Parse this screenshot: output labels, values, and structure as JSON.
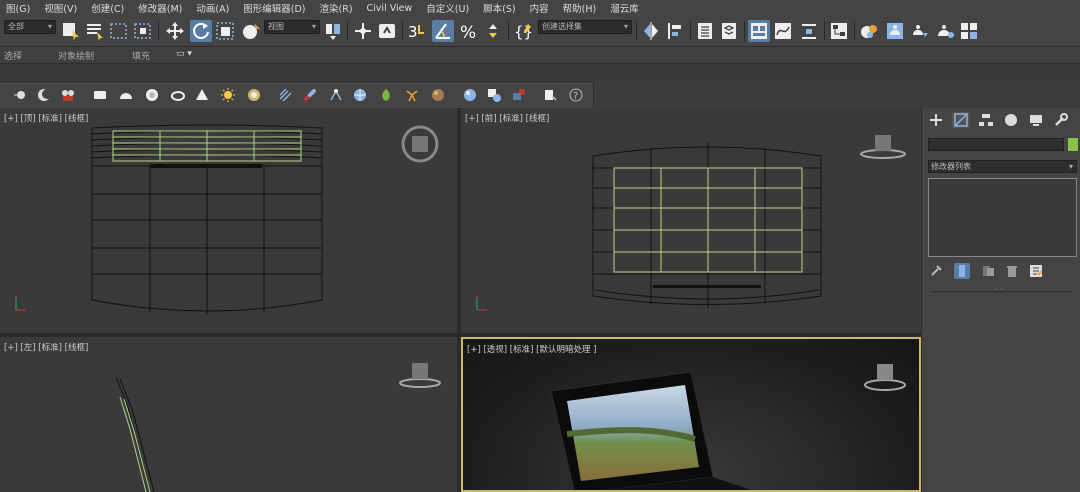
{
  "menu": [
    "图(G)",
    "视图(V)",
    "创建(C)",
    "修改器(M)",
    "动画(A)",
    "图形编辑器(D)",
    "渲染(R)",
    "Civil View",
    "自定义(U)",
    "脚本(S)",
    "内容",
    "帮助(H)",
    "溜云库"
  ],
  "toolbar": {
    "selection_filter": "全部",
    "ref_coord": "视图",
    "named_selection": "创建选择集"
  },
  "ribbon": {
    "tabs": [
      "选择",
      "对象绘制",
      "填充"
    ]
  },
  "viewports": {
    "top": "[+] [顶] [标准] [线框]",
    "front": "[+] [前] [标准] [线框]",
    "left": "[+] [左] [标准] [线框]",
    "perspective": "[+] [透视] [标准] [默认明暗处理 ]"
  },
  "command_panel": {
    "modifier_list": "修改器列表",
    "object_color": "#8bc34a"
  },
  "colors": {
    "accent": "#5a7da6",
    "active_viewport": "#c9b96c",
    "selection": "#b7d48a"
  },
  "icons": [
    "select-object-icon",
    "select-by-name-icon",
    "rect-region-icon",
    "window-crossing-icon",
    "move-icon",
    "rotate-icon",
    "scale-icon",
    "placement-icon",
    "link-icon",
    "snaps-3d-icon",
    "angle-snap-icon",
    "percent-snap-icon",
    "spinner-snap-icon",
    "edit-named-sets-icon",
    "mirror-icon",
    "align-icon",
    "scene-explorer-icon",
    "layer-explorer-icon",
    "ribbon-toggle-icon",
    "curve-editor-icon",
    "schematic-icon",
    "material-editor-icon",
    "render-setup-icon",
    "rendered-frame-icon",
    "render-production-icon",
    "render-iterative-icon",
    "render-cloud-icon"
  ]
}
